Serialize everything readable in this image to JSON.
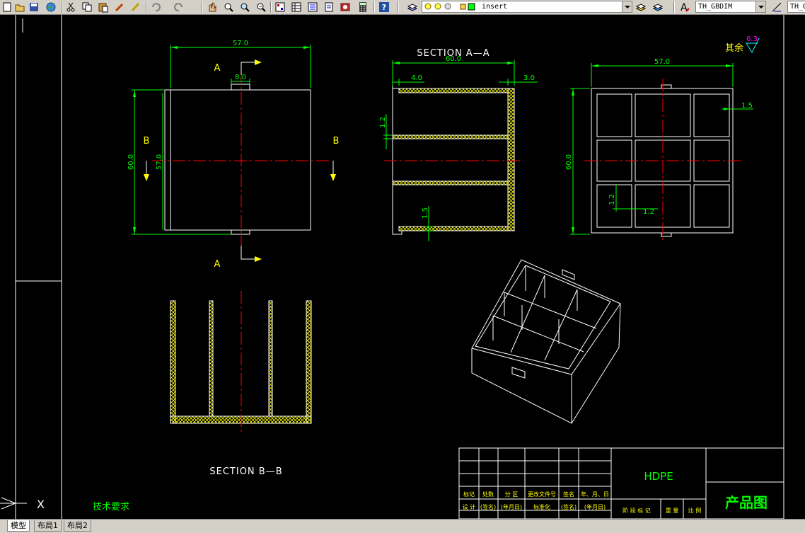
{
  "toolbar": {
    "layer_value": "insert",
    "textstyle_value": "TH_GBDIM",
    "dimstyle_value": "TH_G"
  },
  "drawing": {
    "front_view": {
      "dim_width": "57.0",
      "dim_tab": "8.0",
      "dim_height": "60.0",
      "dim_inner": "57.0",
      "label_a_top": "A",
      "label_a_bottom": "A",
      "label_b_left": "B",
      "label_b_right": "B"
    },
    "section_aa": {
      "title": "SECTION  A—A",
      "dim_width": "60.0",
      "dim_left": "4.0",
      "dim_right": "3.0",
      "dim_wall": "1.2",
      "dim_bottom": "1.5"
    },
    "top_view": {
      "dim_width": "57.0",
      "dim_height": "60.0",
      "dim_wall": "1.5",
      "dim_rib_v": "1.2",
      "dim_rib_h": "1.2"
    },
    "section_bb": {
      "title": "SECTION  B—B"
    },
    "roughness": {
      "label": "其余",
      "value": "6.3"
    },
    "tech_req": "技术要求",
    "title_block": {
      "material": "HDPE",
      "drawing_name": "产品图",
      "row1": [
        "标记",
        "处数",
        "分 区",
        "更改文件号",
        "签名",
        "年、月、日"
      ],
      "row2": [
        "设 计",
        "(签名)",
        "(年月日)",
        "标准化",
        "(签名)",
        "(年月日)"
      ],
      "row2_right": [
        "阶 段 标 记",
        "重 量",
        "比 例"
      ]
    },
    "ucs": {
      "x_label": "X"
    }
  },
  "tabs": [
    {
      "label": "模型"
    },
    {
      "label": "布局1"
    },
    {
      "label": "布局2"
    }
  ],
  "colors": {
    "background": "#000000",
    "geometry": "#ffffff",
    "dimension": "#00ff00",
    "centerline": "#ff0000",
    "hatch": "#ffff00",
    "section_title": "#ffffff",
    "roughness_value": "#ff00ff",
    "title_text": "#00ff00"
  }
}
